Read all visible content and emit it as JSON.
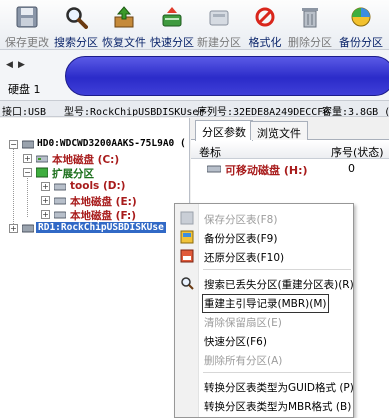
{
  "toolbar": {
    "buttons": [
      {
        "label": "保存更改",
        "icon": "save-icon"
      },
      {
        "label": "搜索分区",
        "icon": "search-icon"
      },
      {
        "label": "恢复文件",
        "icon": "recover-files-icon"
      },
      {
        "label": "快速分区",
        "icon": "quick-partition-icon"
      },
      {
        "label": "新建分区",
        "icon": "new-partition-icon"
      },
      {
        "label": "格式化",
        "icon": "format-icon"
      },
      {
        "label": "删除分区",
        "icon": "delete-partition-icon"
      },
      {
        "label": "备份分区",
        "icon": "backup-partition-icon"
      }
    ]
  },
  "disk": {
    "label": "硬盘 1",
    "interface": "接口:USB",
    "model": "型号:RockChipUSBDISKUser",
    "serial": "序列号:32EDE8A249DECCF0",
    "capacity": "容量:3.8GB (3"
  },
  "tree": {
    "disk1": "HD0:WDCWD3200AAKS-75L9A0 (",
    "local_c": "本地磁盘 (C:)",
    "extended": "扩展分区",
    "tools": "tools (D:)",
    "local_e": "本地磁盘 (E:)",
    "local_f": "本地磁盘 (F:)",
    "disk2": "RD1:RockChipUSBDISKUse"
  },
  "right": {
    "tabs": [
      "分区参数",
      "浏览文件"
    ],
    "columns": {
      "label": "卷标",
      "seq": "序号(状态)"
    },
    "row": {
      "name": "可移动磁盘 (H:)",
      "seq": "0"
    }
  },
  "menu": {
    "items": [
      {
        "label": "保存分区表(F8)",
        "disabled": true
      },
      {
        "label": "备份分区表(F9)",
        "disabled": false
      },
      {
        "label": "还原分区表(F10)",
        "disabled": false
      },
      {
        "label": "搜索已丢失分区(重建分区表)(R)",
        "disabled": false
      },
      {
        "label": "重建主引导记录(MBR)(M)",
        "disabled": false
      },
      {
        "label": "清除保留扇区(E)",
        "disabled": true
      },
      {
        "label": "快速分区(F6)",
        "disabled": false
      },
      {
        "label": "删除所有分区(A)",
        "disabled": true
      },
      {
        "label": "转换分区表类型为GUID格式 (P)",
        "disabled": false
      },
      {
        "label": "转换分区表类型为MBR格式 (B)",
        "disabled": false
      }
    ]
  }
}
